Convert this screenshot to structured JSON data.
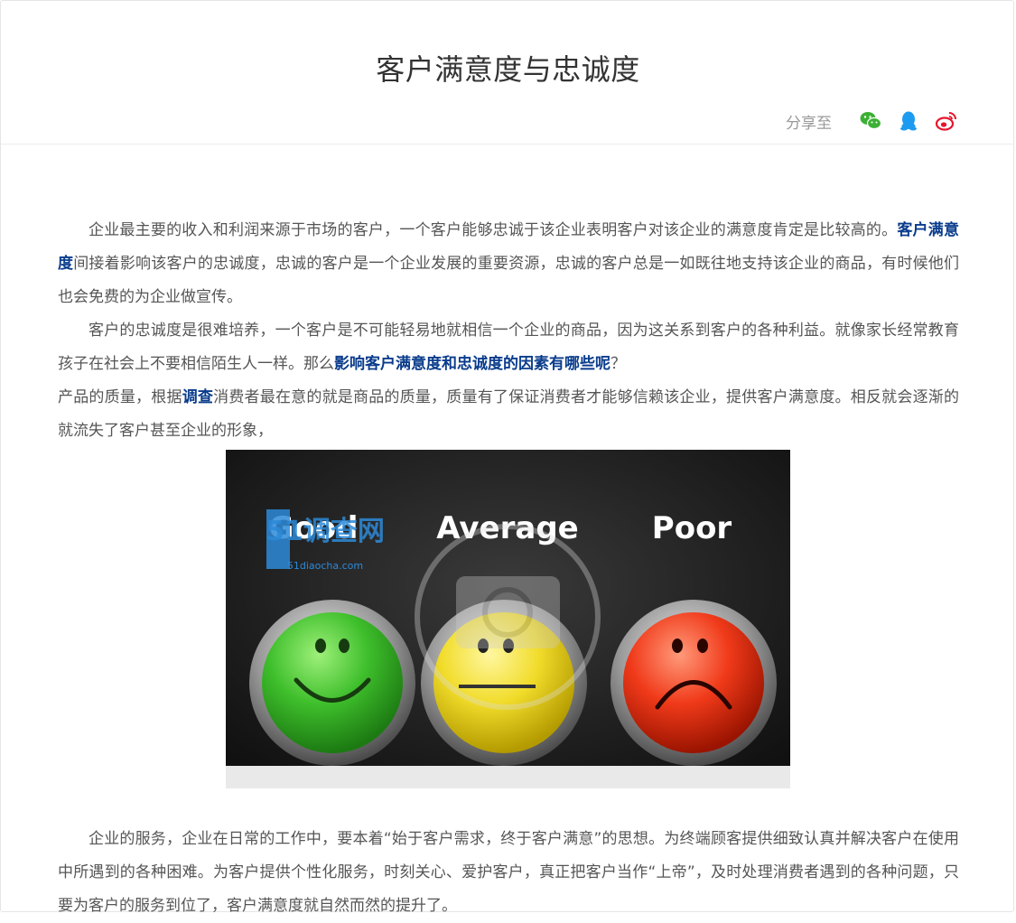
{
  "article": {
    "title": "客户满意度与忠诚度",
    "share_label": "分享至",
    "share_icons": [
      "wechat-icon",
      "qq-icon",
      "weibo-icon"
    ],
    "colors": {
      "title": "#333333",
      "body_text": "#555555",
      "keyword_link": "#0a3c8c",
      "wechat": "#3cb034",
      "qq": "#1d9bf0",
      "weibo": "#e6162d"
    },
    "p1": {
      "text1": "企业最主要的收入和利润来源于市场的客户，一个客户能够忠诚于该企业表明客户对该企业的满意度肯定是比较高的。",
      "link": "客户满意度",
      "text2": "间接着影响该客户的忠诚度，忠诚的客户是一个企业发展的重要资源，忠诚的客户总是一如既往地支持该企业的商品，有时候他们也会免费的为企业做宣传。"
    },
    "p2": {
      "text1": "客户的忠诚度是很难培养，一个客户是不可能轻易地就相信一个企业的商品，因为这关系到客户的各种利益。就像家长经常教育孩子在社会上不要相信陌生人一样。那么",
      "link": "影响客户满意度和忠诚度的因素有哪些呢",
      "text2": "？"
    },
    "p3": {
      "text1": "产品的质量，根据",
      "link": "调查",
      "text2": "消费者最在意的就是商品的质量，质量有了保证消费者才能够信赖该企业，提供客户满意度。相反就会逐渐的就流失了客户甚至企业的形象，"
    },
    "image": {
      "labels": [
        "Good",
        "Average",
        "Poor"
      ],
      "watermark_logo": "51调查网",
      "watermark_url": "51diaocha.com"
    },
    "p4": {
      "text": "企业的服务，企业在日常的工作中，要本着“始于客户需求，终于客户满意”的思想。为终端顾客提供细致认真并解决客户在使用中所遇到的各种困难。为客户提供个性化服务，时刻关心、爱护客户，真正把客户当作“上帝”，及时处理消费者遇到的各种问题，只要为客户的服务到位了，客户满意度就自然而然的提升了。"
    }
  }
}
